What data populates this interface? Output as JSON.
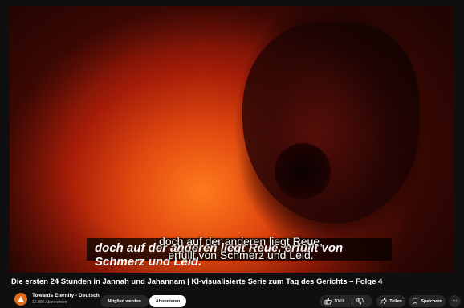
{
  "video": {
    "subtitle_back": "doch auf der anderen liegt Reue, erfüllt von Schmerz und Leid.",
    "subtitle_front_line1": "doch auf der anderen liegt Reue,",
    "subtitle_front_line2": "erfüllt von Schmerz und Leid."
  },
  "title": "Die ersten 24 Stunden in Jannah und Jahannam | KI-visualisierte Serie zum Tag des Gerichts – Folge 4",
  "channel": {
    "name": "Towards Eternity - Deutsch",
    "subscribers": "12.000 Abonnenten",
    "member_label": "Mitglied werden",
    "subscribe_label": "Abonnieren"
  },
  "actions": {
    "like_count": "1069",
    "share_label": "Teilen",
    "save_label": "Speichern",
    "more_label": "⋯"
  },
  "colors": {
    "background": "#0f0f0f",
    "pill": "#272727",
    "subscribe": "#ffffff",
    "avatar": "#e06a1e"
  },
  "icons": [
    "thumbs-up-icon",
    "thumbs-down-icon",
    "share-icon",
    "save-icon",
    "more-icon"
  ]
}
